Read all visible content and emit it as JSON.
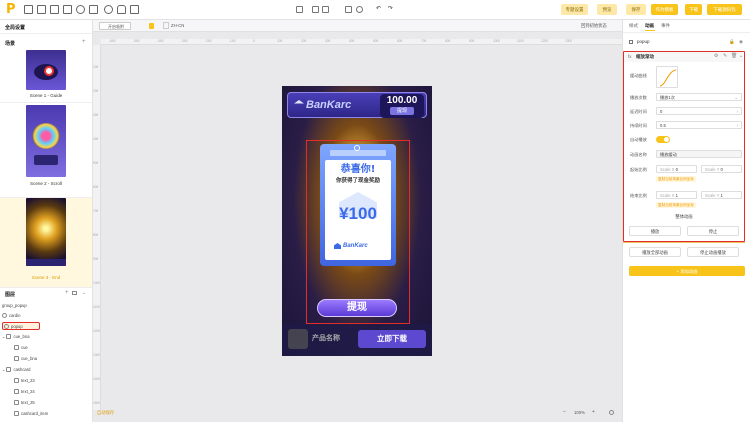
{
  "toolbar": {
    "logo": "P",
    "buttons": [
      "专题设置",
      "预览",
      "保存",
      "作为模板",
      "下载",
      "下载源码包"
    ]
  },
  "left": {
    "global_title": "全局设置",
    "scene_title": "场景",
    "scenes": [
      {
        "label": "Scene 1 - Guide"
      },
      {
        "label": "Scene 2 - Scroll"
      },
      {
        "label": "Scene 3 - End",
        "active": true
      }
    ],
    "layer_title": "图层",
    "layers": [
      {
        "label": "group_popup",
        "indent": 0
      },
      {
        "label": "cardin",
        "indent": 0
      },
      {
        "label": "popup",
        "indent": 0,
        "selected": true
      },
      {
        "label": "cue_bna",
        "indent": 0
      },
      {
        "label": "cue",
        "indent": 1
      },
      {
        "label": "cue_bna",
        "indent": 1
      },
      {
        "label": "cashcard",
        "indent": 0
      },
      {
        "label": "text_23",
        "indent": 1
      },
      {
        "label": "text_24",
        "indent": 1
      },
      {
        "label": "text_25",
        "indent": 1
      },
      {
        "label": "cashcard_item",
        "indent": 1
      }
    ]
  },
  "canvas": {
    "toolbar": {
      "cursor": "开启吸附",
      "lang": "ZH-CN",
      "right": "回到初始状态"
    },
    "ruler_h": [
      "-600",
      "-500",
      "-400",
      "-300",
      "-200",
      "-100",
      "0",
      "100",
      "200",
      "300",
      "400",
      "500",
      "600",
      "700",
      "800",
      "900",
      "1000",
      "1100",
      "1200",
      "1300"
    ],
    "ruler_v": [
      "100",
      "200",
      "300",
      "400",
      "500",
      "600",
      "700",
      "800",
      "900",
      "1000",
      "1100",
      "1200",
      "1300",
      "1400",
      "1500"
    ],
    "status_left": "自动保存",
    "zoom": "100%",
    "ad": {
      "brand": "BanKarc",
      "balance": "100.00",
      "balance_btn": "提现",
      "popup_title": "恭喜你!",
      "popup_sub": "你获得了现金奖励",
      "amount": "¥100",
      "card_brand": "BanKarc",
      "cta": "提现",
      "product": "产品名称",
      "download": "立即下载"
    }
  },
  "right": {
    "tabs": [
      "样式",
      "动画",
      "事件"
    ],
    "node_name": "popup",
    "anim_title": "缩放渐动",
    "rows": [
      {
        "label": "缓动曲线",
        "value": ""
      },
      {
        "label": "播放次数",
        "value": "播放1次"
      },
      {
        "label": "延迟时间",
        "value": "0"
      },
      {
        "label": "持续时间",
        "value": "0.5"
      },
      {
        "label": "自动播放",
        "value": ""
      },
      {
        "label": "动画名称",
        "value": "播放缓动"
      }
    ],
    "start_label": "起始比例",
    "end_label": "结束比例",
    "scale_x": "Scale X",
    "scale_y": "Scale Y",
    "start_x": "0",
    "start_y": "0",
    "end_x": "1",
    "end_y": "1",
    "link_text": "复制当前场景比例坐标",
    "group_btn": "整体动画",
    "play_btn": "播放",
    "stop_btn": "停止",
    "play_all": "播放全部动画",
    "stop_all": "停止动画播放",
    "add_btn": "+ 添加动画",
    "accent": "#f8c41a",
    "highlight": "#e52d27"
  }
}
